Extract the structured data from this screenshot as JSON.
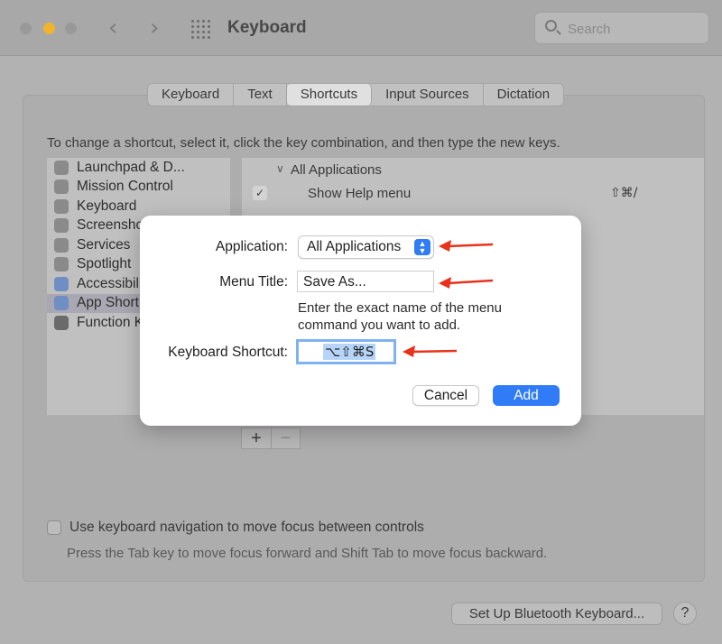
{
  "window": {
    "title": "Keyboard"
  },
  "search": {
    "placeholder": "Search"
  },
  "tabs": [
    {
      "label": "Keyboard"
    },
    {
      "label": "Text"
    },
    {
      "label": "Shortcuts"
    },
    {
      "label": "Input Sources"
    },
    {
      "label": "Dictation"
    }
  ],
  "active_tab": "Shortcuts",
  "instructions": "To change a shortcut, select it, click the key combination, and then type the new keys.",
  "categories": [
    {
      "label": "Launchpad & D...",
      "icon": "launchpad-icon"
    },
    {
      "label": "Mission Control",
      "icon": "mission-control-icon"
    },
    {
      "label": "Keyboard",
      "icon": "keyboard-icon"
    },
    {
      "label": "Screensho",
      "icon": "screenshot-icon"
    },
    {
      "label": "Services",
      "icon": "gear-icon"
    },
    {
      "label": "Spotlight",
      "icon": "magnifier-icon"
    },
    {
      "label": "Accessibili",
      "icon": "accessibility-icon"
    },
    {
      "label": "App Short",
      "icon": "app-shortcuts-icon"
    },
    {
      "label": "Function K",
      "icon": "fn-icon"
    }
  ],
  "selected_category": "App Short",
  "shortcuts": {
    "group_label": "All Applications",
    "items": [
      {
        "label": "Show Help menu",
        "keys": "⇧⌘/",
        "checked": true
      }
    ]
  },
  "list_controls": {
    "add": "+",
    "remove": "−"
  },
  "keyboard_navigation": {
    "label": "Use keyboard navigation to move focus between controls",
    "description": "Press the Tab key to move focus forward and Shift Tab to move focus backward.",
    "checked": false
  },
  "bluetooth_button": "Set Up Bluetooth Keyboard...",
  "help_button": "?",
  "dialog": {
    "application_label": "Application:",
    "application_value": "All Applications",
    "menu_title_label": "Menu Title:",
    "menu_title_value": "Save As...",
    "hint": "Enter the exact name of the menu command you want to add.",
    "shortcut_label": "Keyboard Shortcut:",
    "shortcut_value": "⌥⇧⌘S",
    "cancel": "Cancel",
    "add": "Add"
  },
  "colors": {
    "accent": "#2f7cf6",
    "annotation_arrow": "#e8321c"
  }
}
